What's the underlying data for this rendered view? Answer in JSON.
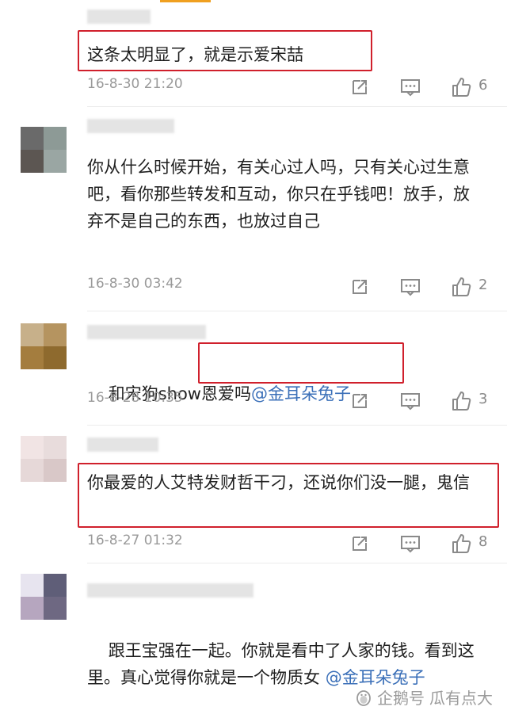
{
  "comments": [
    {
      "text": "这条太明显了，就是示爱宋喆",
      "time": "16-8-30 21:20",
      "likes": "6"
    },
    {
      "text": "你从什么时候开始，有关心过人吗，只有关心过生意吧，看你那些转发和互动，你只在乎钱吧！放手，放弃不是自己的东西，也放过自己",
      "time": "16-8-30 03:42",
      "likes": "2"
    },
    {
      "text_prefix": "和宋狗show恩爱吗",
      "mention": "@金耳朵兔子",
      "time": "16-8-28 10:35",
      "likes": "3"
    },
    {
      "text": "你最爱的人艾特发财哲干刁，还说你们没一腿，鬼信",
      "time": "16-8-27 01:32",
      "likes": "8"
    },
    {
      "text_prefix": "跟王宝强在一起。你就是看中了人家的钱。看到这里。真心觉得你就是一个物质女 ",
      "mention": "@金耳朵兔子"
    }
  ],
  "watermark": {
    "brand": "企鹅号",
    "author": "瓜有点大"
  },
  "colors": {
    "highlight_box": "#d0202c",
    "mention": "#3a6fb8",
    "meta_text": "#9a9a9a"
  }
}
